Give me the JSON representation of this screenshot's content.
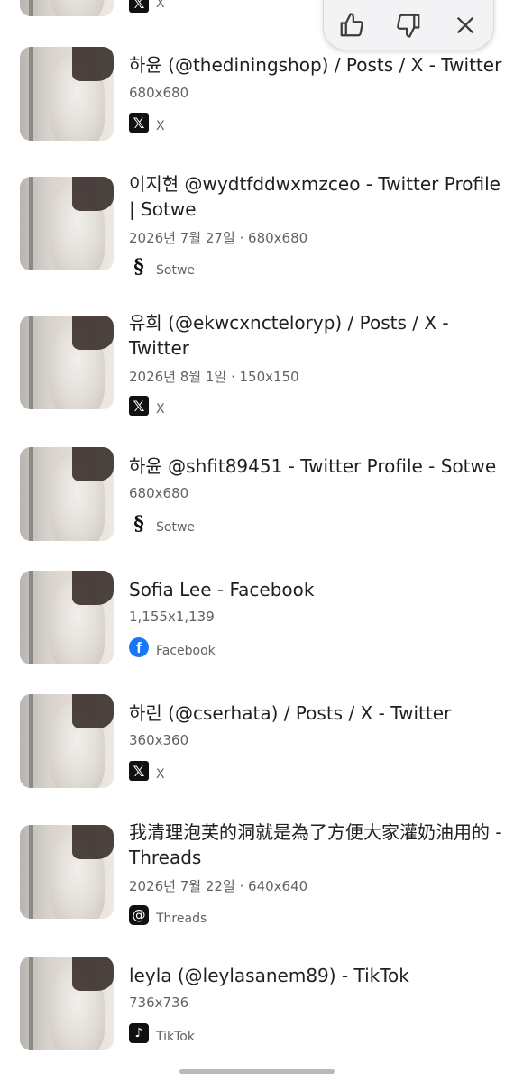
{
  "feedback": {
    "thumbs_up_icon": "thumbs-up-icon",
    "thumbs_down_icon": "thumbs-down-icon",
    "close_icon": "close-icon"
  },
  "top_partial": {
    "source": "X"
  },
  "results": [
    {
      "title": "하윤 (@thediningshop) / Posts / X - Twitter",
      "meta": "680x680",
      "source": "X",
      "icon": "x-icon"
    },
    {
      "title": "이지현 @wydtfddwxmzceo - Twitter Profile | Sotwe",
      "meta": "2026년 7월 27일 · 680x680",
      "source": "Sotwe",
      "icon": "sotwe-icon"
    },
    {
      "title": "유희 (@ekwcxncteloryp) / Posts / X - Twitter",
      "meta": "2026년 8월 1일 · 150x150",
      "source": "X",
      "icon": "x-icon"
    },
    {
      "title": "하윤 @shfit89451 - Twitter Profile - Sotwe",
      "meta": "680x680",
      "source": "Sotwe",
      "icon": "sotwe-icon"
    },
    {
      "title": "Sofia Lee - Facebook",
      "meta": "1,155x1,139",
      "source": "Facebook",
      "icon": "facebook-icon"
    },
    {
      "title": "하린 (@cserhata) / Posts / X - Twitter",
      "meta": "360x360",
      "source": "X",
      "icon": "x-icon"
    },
    {
      "title": "我清理泡芙的洞就是為了方便大家灌奶油用的 - Threads",
      "meta": "2026년 7월 22일 · 640x640",
      "source": "Threads",
      "icon": "threads-icon"
    },
    {
      "title": "leyla (@leylasanem89) - TikTok",
      "meta": "736x736",
      "source": "TikTok",
      "icon": "tiktok-icon"
    }
  ]
}
